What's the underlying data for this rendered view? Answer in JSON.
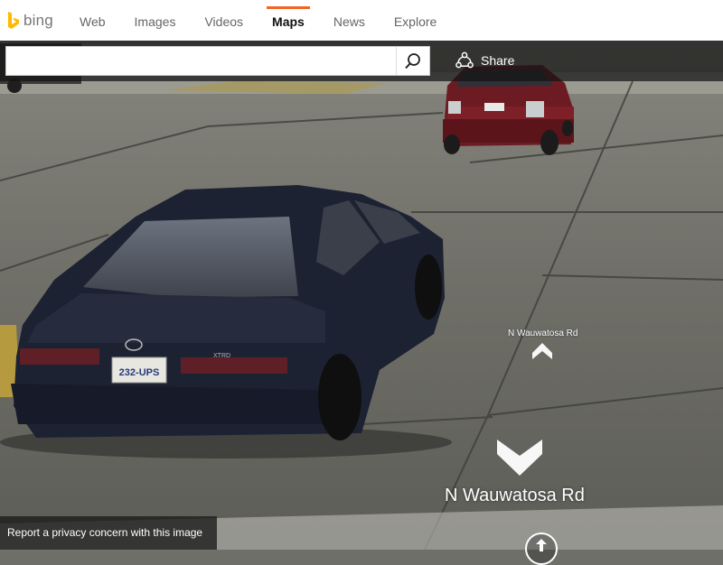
{
  "brand": {
    "name": "bing",
    "accent": "#f26522",
    "logo_color": "#ffb900"
  },
  "nav": {
    "tabs": [
      {
        "label": "Web"
      },
      {
        "label": "Images"
      },
      {
        "label": "Videos"
      },
      {
        "label": "Maps",
        "active": true
      },
      {
        "label": "News"
      },
      {
        "label": "Explore"
      }
    ]
  },
  "search": {
    "value": "",
    "placeholder": "",
    "icon": "search-icon"
  },
  "share": {
    "label": "Share",
    "icon": "share-icon"
  },
  "streetside": {
    "road_label_ahead": "N Wauwatosa Rd",
    "road_label_behind": "N Wauwatosa Rd",
    "license_plate": "232-UPS",
    "privacy_link": "Report a privacy concern with this image"
  }
}
